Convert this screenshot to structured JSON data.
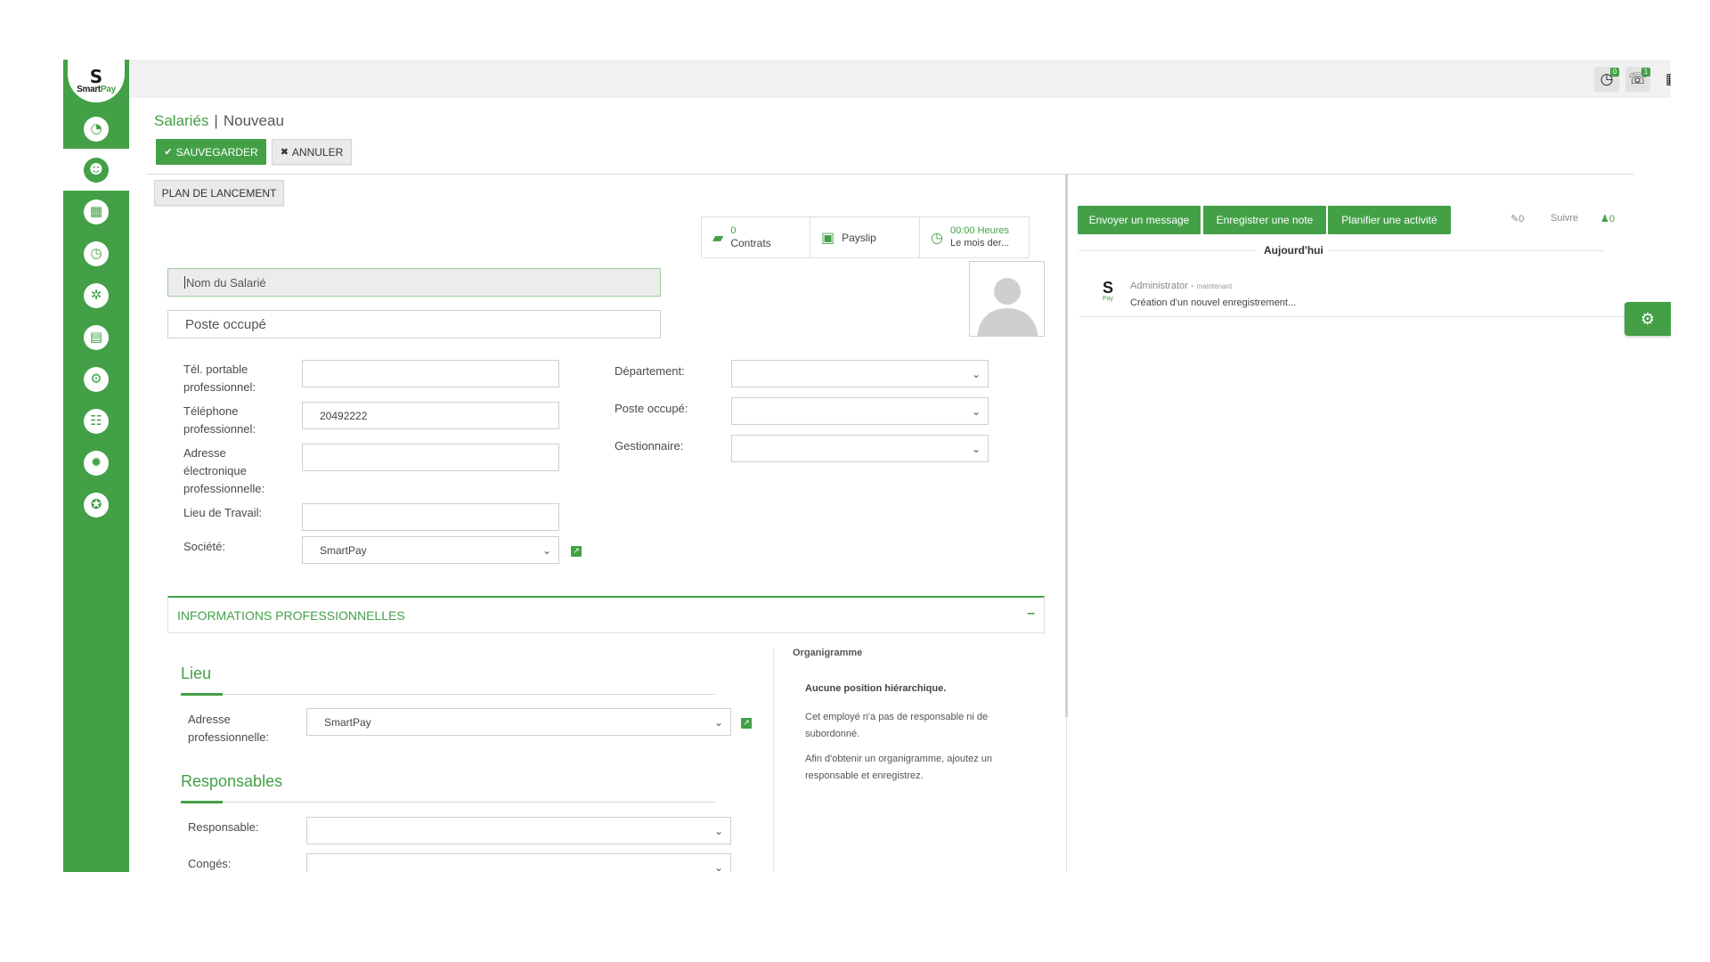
{
  "brand": {
    "logo_letter": "S",
    "logo_smart": "Smart",
    "logo_pay": "Pay",
    "accent": "#43a047"
  },
  "sidebar": {
    "items": [
      {
        "name": "dashboard-icon",
        "glyph": "◔"
      },
      {
        "name": "employees-icon",
        "glyph": "☻"
      },
      {
        "name": "calendar-icon",
        "glyph": "▦"
      },
      {
        "name": "timesheet-icon",
        "glyph": "◷"
      },
      {
        "name": "settings-cog-icon",
        "glyph": "✲"
      },
      {
        "name": "document-icon",
        "glyph": "▤"
      },
      {
        "name": "user-settings-icon",
        "glyph": "⚙"
      },
      {
        "name": "payroll-icon",
        "glyph": "☷"
      },
      {
        "name": "gear-icon",
        "glyph": "✹"
      },
      {
        "name": "compass-icon",
        "glyph": "✪"
      }
    ]
  },
  "topbar": {
    "activity_badge": "0",
    "messages_badge": "1",
    "activity_glyph": "◷",
    "messages_glyph": "☏",
    "calculator_glyph": "▦"
  },
  "breadcrumb": {
    "parent": "Salariés",
    "separator": "|",
    "current": "Nouveau"
  },
  "toolbar": {
    "save_icon": "✔",
    "save_label": "SAUVEGARDER",
    "cancel_icon": "✖",
    "cancel_label": "ANNULER",
    "launch_plan_label": "PLAN DE LANCEMENT"
  },
  "stats": {
    "contracts_count": "0",
    "contracts_label": "Contrats",
    "payslip_label": "Payslip",
    "hours_value": "00:00 Heures",
    "hours_label": "Le mois der..."
  },
  "employee": {
    "name_placeholder": "Nom du Salarié",
    "job_placeholder": "Poste occupé"
  },
  "form": {
    "mobile_label_1": "Tél. portable",
    "mobile_label_2": "professionnel:",
    "mobile_value": "",
    "phone_label_1": "Téléphone",
    "phone_label_2": "professionnel:",
    "phone_value": "20492222",
    "email_label_1": "Adresse",
    "email_label_2": "électronique",
    "email_label_3": "professionnelle:",
    "email_value": "",
    "workplace_label": "Lieu de Travail:",
    "workplace_value": "",
    "company_label": "Société:",
    "company_value": "SmartPay",
    "department_label": "Département:",
    "department_value": "",
    "position_label": "Poste occupé:",
    "position_value": "",
    "manager_label": "Gestionnaire:",
    "manager_value": ""
  },
  "section": {
    "title": "INFORMATIONS PROFESSIONNELLES",
    "collapse_symbol": "–",
    "location_heading": "Lieu",
    "work_address_label_1": "Adresse",
    "work_address_label_2": "professionnelle:",
    "work_address_value": "SmartPay",
    "managers_heading": "Responsables",
    "responsible_label": "Responsable:",
    "responsible_value": "",
    "leave_label": "Congés:",
    "leave_value": ""
  },
  "org_chart": {
    "title": "Organigramme",
    "headline": "Aucune position hiérarchique.",
    "line_1": "Cet employé n'a pas de responsable ni de",
    "line_2": "subordonné.",
    "line_3": "Afin d'obtenir un organigramme, ajoutez un",
    "line_4": "responsable et enregistrez."
  },
  "chatter": {
    "send_message": "Envoyer un message",
    "log_note": "Enregistrer une note",
    "schedule_activity": "Planifier une activité",
    "attachments_count": "0",
    "follow_label": "Suivre",
    "followers_count": "0",
    "today_label": "Aujourd'hui",
    "author": "Administrator",
    "author_sep": " - ",
    "time": "maintenant",
    "message": "Création d'un nouvel enregistrement..."
  }
}
